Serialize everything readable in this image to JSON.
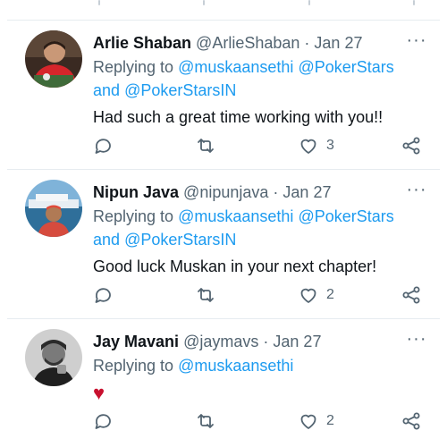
{
  "tweets": [
    {
      "name": "Arlie Shaban",
      "handle": "@ArlieShaban",
      "separator": "·",
      "date": "Jan 27",
      "replying_prefix": "Replying to",
      "mention1": "@muskaansethi",
      "mention2": "@PokerStars",
      "and_word": "and",
      "mention3": "@PokerStarsIN",
      "text": "Had such a great time working with you!!",
      "like_count": "3",
      "more": "···"
    },
    {
      "name": "Nipun Java",
      "handle": "@nipunjava",
      "separator": "·",
      "date": "Jan 27",
      "replying_prefix": "Replying to",
      "mention1": "@muskaansethi",
      "mention2": "@PokerStars",
      "and_word": "and",
      "mention3": "@PokerStarsIN",
      "text": "Good luck Muskan in your next chapter!",
      "like_count": "2",
      "more": "···"
    },
    {
      "name": "Jay Mavani",
      "handle": "@jaymavs",
      "separator": "·",
      "date": "Jan 27",
      "replying_prefix": "Replying to",
      "mention1": "@muskaansethi",
      "text": "♥",
      "like_count": "2",
      "more": "···"
    }
  ],
  "icons": {
    "reply": "reply-icon",
    "retweet": "retweet-icon",
    "like": "heart-icon",
    "share": "share-icon",
    "more": "more-options-icon"
  },
  "colors": {
    "link": "#1d9bf0",
    "secondary_text": "#536471",
    "primary_text": "#0f1419",
    "divider": "#e6ecf0",
    "heart_emoji": "#c8102e"
  }
}
